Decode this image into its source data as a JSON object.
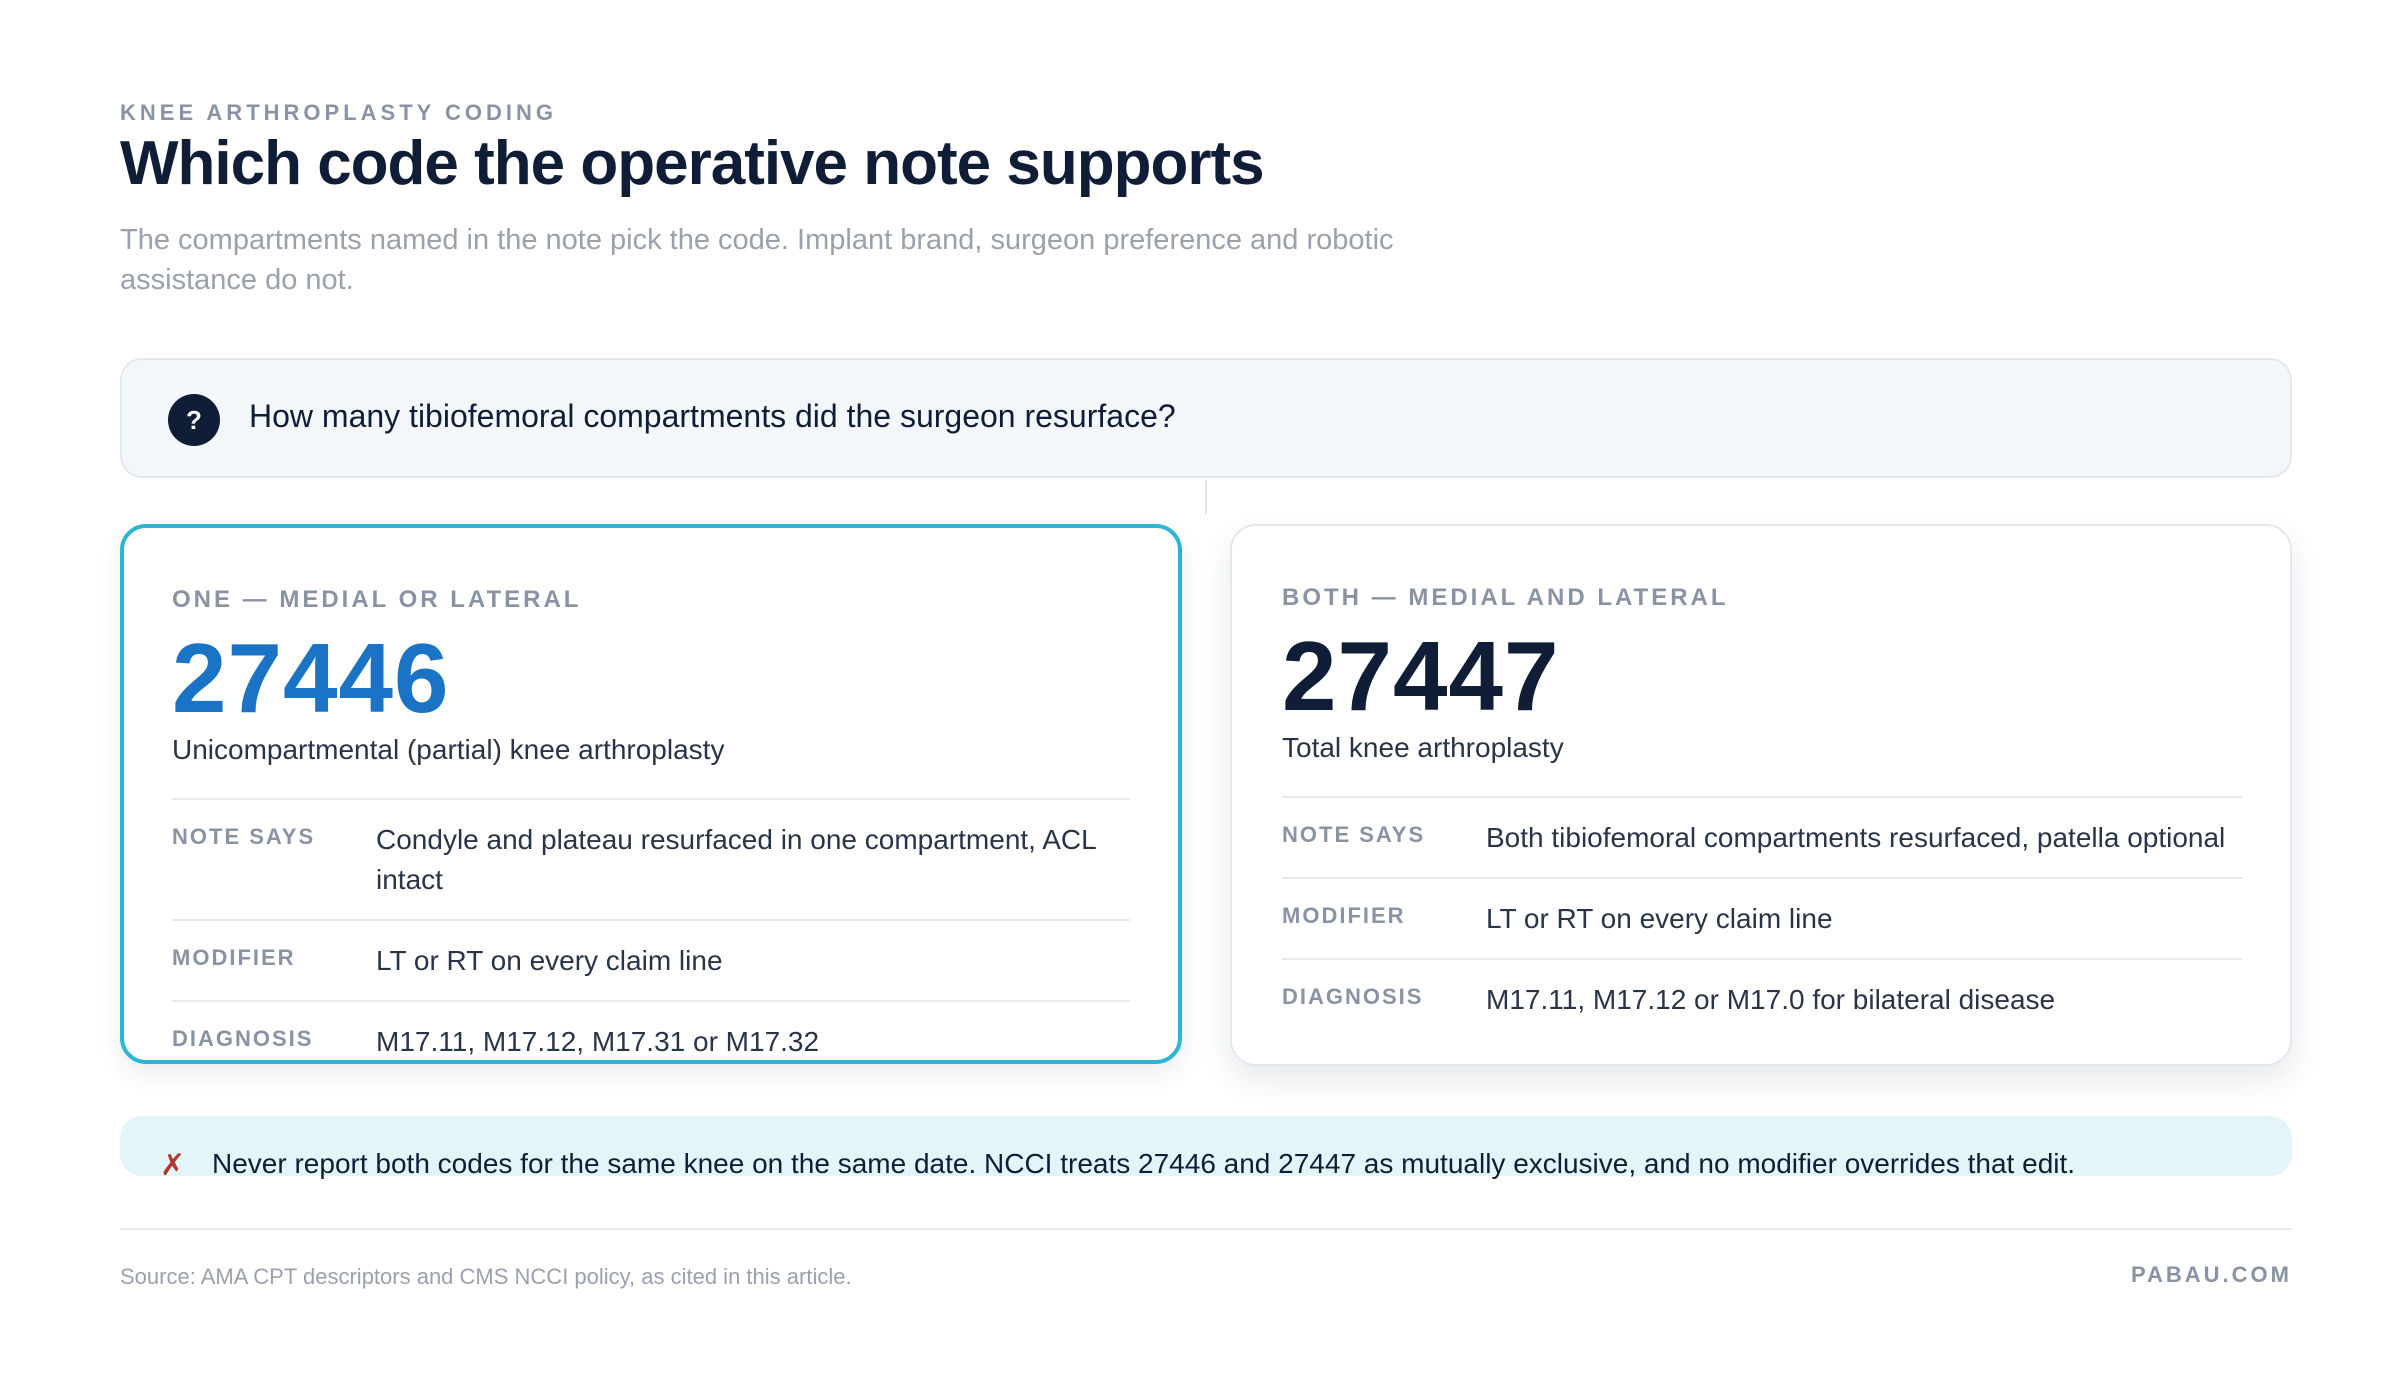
{
  "header": {
    "eyebrow": "KNEE ARTHROPLASTY CODING",
    "title": "Which code the operative note supports",
    "subtitle": "The compartments named in the note pick the code. Implant brand, surgeon preference and robotic assistance do not."
  },
  "question": {
    "icon": "?",
    "text": "How many tibiofemoral compartments did the surgeon resurface?"
  },
  "cards": [
    {
      "eyebrow": "ONE — MEDIAL OR LATERAL",
      "code": "27446",
      "description": "Unicompartmental (partial) knee arthroplasty",
      "accent": "#1a73c5",
      "border": "#2bb7d3",
      "rows": [
        {
          "label": "NOTE SAYS",
          "value": "Condyle and plateau resurfaced in one compartment, ACL intact"
        },
        {
          "label": "MODIFIER",
          "value": "LT or RT on every claim line"
        },
        {
          "label": "DIAGNOSIS",
          "value": "M17.11, M17.12, M17.31 or M17.32"
        }
      ]
    },
    {
      "eyebrow": "BOTH — MEDIAL AND LATERAL",
      "code": "27447",
      "description": "Total knee arthroplasty",
      "accent": "#0f1e36",
      "rows": [
        {
          "label": "NOTE SAYS",
          "value": "Both tibiofemoral compartments resurfaced, patella optional"
        },
        {
          "label": "MODIFIER",
          "value": "LT or RT on every claim line"
        },
        {
          "label": "DIAGNOSIS",
          "value": "M17.11, M17.12 or M17.0 for bilateral disease"
        }
      ]
    }
  ],
  "warning": {
    "icon": "✗",
    "text": "Never report both codes for the same knee on the same date. NCCI treats 27446 and 27447 as mutually exclusive, and no modifier overrides that edit."
  },
  "footer": {
    "source": "Source: AMA CPT descriptors and CMS NCCI policy, as cited in this article.",
    "brand": "PABAU.COM"
  }
}
